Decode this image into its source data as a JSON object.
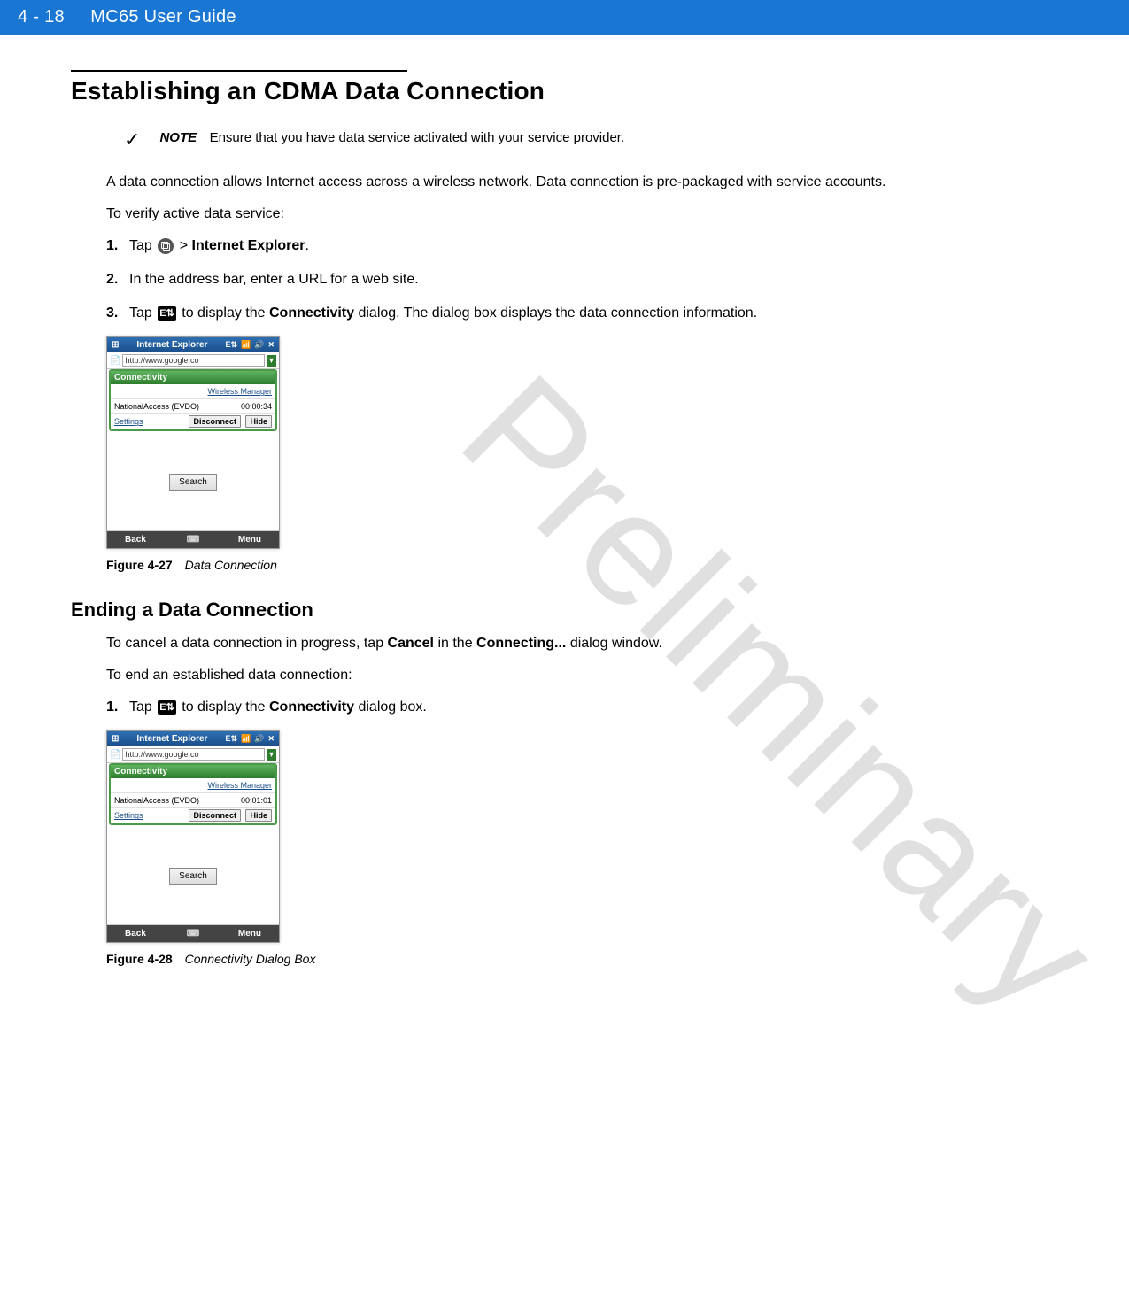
{
  "header": {
    "page_number": "4 - 18",
    "guide_title": "MC65 User Guide"
  },
  "watermark": "Preliminary",
  "section": {
    "heading": "Establishing an CDMA Data Connection",
    "note_label": "NOTE",
    "note_text": "Ensure that you have data service activated with your service provider.",
    "intro": "A data connection allows Internet access across a wireless network. Data connection is pre-packaged with service accounts.",
    "verify_intro": "To verify active data service:",
    "steps": [
      {
        "num": "1.",
        "prefix": "Tap ",
        "after_icon": " > ",
        "bold": "Internet Explorer",
        "suffix": "."
      },
      {
        "num": "2.",
        "text": "In the address bar, enter a URL for a web site."
      },
      {
        "num": "3.",
        "prefix": "Tap ",
        "mid": " to display the ",
        "bold": "Connectivity",
        "suffix": " dialog. The dialog box displays the data connection information."
      }
    ]
  },
  "figure1": {
    "label": "Figure 4-27",
    "title": "Data Connection",
    "phone": {
      "title": "Internet Explorer",
      "url": "http://www.google.co",
      "panel_title": "Connectivity",
      "wireless_manager": "Wireless Manager",
      "conn_name": "NationalAccess (EVDO)",
      "conn_time": "00:00:34",
      "settings": "Settings",
      "disconnect": "Disconnect",
      "hide": "Hide",
      "search": "Search",
      "back": "Back",
      "menu": "Menu"
    }
  },
  "subsection": {
    "heading": "Ending a Data Connection",
    "cancel_text_prefix": "To cancel a data connection in progress, tap ",
    "cancel_bold": "Cancel",
    "cancel_mid": " in the ",
    "connecting_bold": "Connecting...",
    "cancel_suffix": " dialog window.",
    "end_intro": "To end an established data connection:",
    "step1_num": "1.",
    "step1_prefix": "Tap  ",
    "step1_mid": "  to display the ",
    "step1_bold": "Connectivity",
    "step1_suffix": " dialog box."
  },
  "figure2": {
    "label": "Figure 4-28",
    "title": "Connectivity Dialog Box",
    "phone": {
      "title": "Internet Explorer",
      "url": "http://www.google.co",
      "panel_title": "Connectivity",
      "wireless_manager": "Wireless Manager",
      "conn_name": "NationalAccess (EVDO)",
      "conn_time": "00:01:01",
      "settings": "Settings",
      "disconnect": "Disconnect",
      "hide": "Hide",
      "search": "Search",
      "back": "Back",
      "menu": "Menu"
    }
  }
}
